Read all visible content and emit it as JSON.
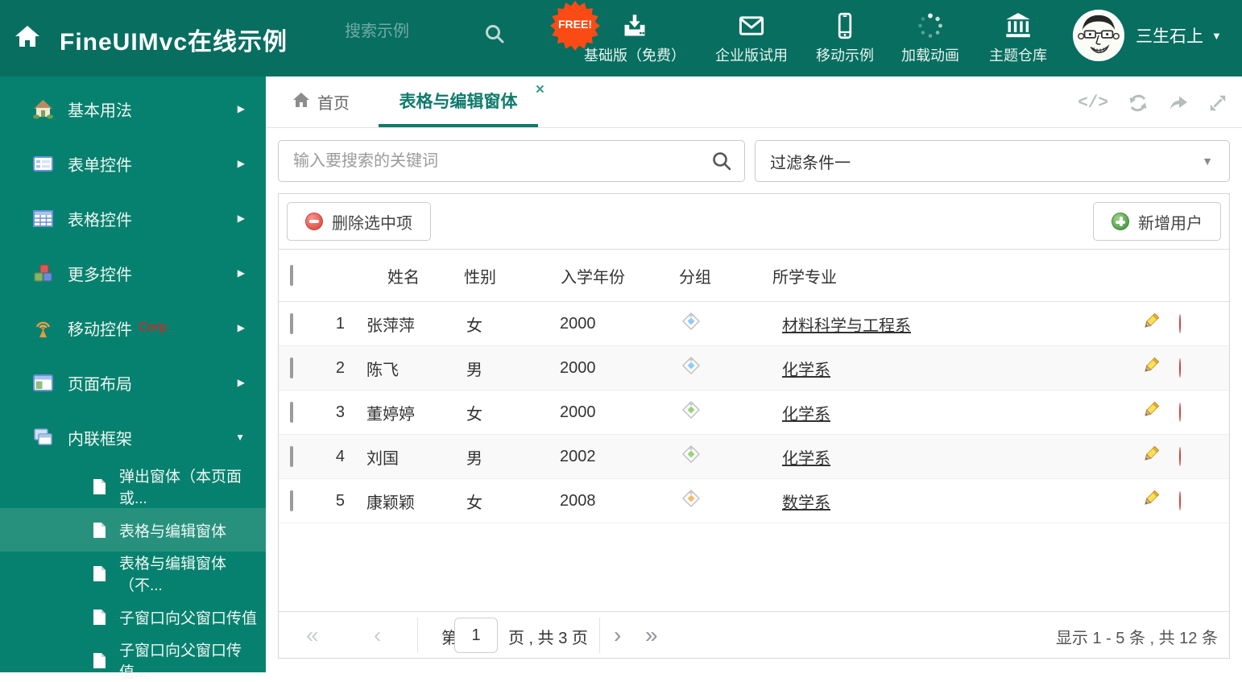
{
  "theme": {
    "topbar_bg": "#076e60",
    "sidebar_bg": "#07816f",
    "sidebar_selected_bg": "#27917e",
    "accent": "#0f7a6c",
    "badge_color": "#fb4b14",
    "danger": "#df544b",
    "success": "#4f9e49",
    "tag_blue": "#8ecdf5",
    "tag_green": "#9bd37a",
    "tag_orange": "#fbb96d"
  },
  "header": {
    "title": "FineUIMvc在线示例",
    "search_placeholder": "搜索示例",
    "badge": "FREE!",
    "nav": [
      {
        "label": "基础版（免费）",
        "icon": "download-icon"
      },
      {
        "label": "企业版试用",
        "icon": "envelope-icon"
      },
      {
        "label": "移动示例",
        "icon": "phone-icon"
      },
      {
        "label": "加载动画",
        "icon": "spinner-icon"
      },
      {
        "label": "主题仓库",
        "icon": "bank-icon"
      }
    ],
    "user_name": "三生石上"
  },
  "sidebar": {
    "items": [
      {
        "label": "基本用法",
        "icon": "home-icon"
      },
      {
        "label": "表单控件",
        "icon": "form-icon"
      },
      {
        "label": "表格控件",
        "icon": "grid-icon"
      },
      {
        "label": "更多控件",
        "icon": "cubes-icon"
      },
      {
        "label": "移动控件",
        "suffix": "Corp.",
        "icon": "antenna-icon"
      },
      {
        "label": "页面布局",
        "icon": "layout-icon"
      },
      {
        "label": "内联框架",
        "icon": "frames-icon"
      }
    ],
    "subitems": [
      {
        "label": "弹出窗体（本页面或..."
      },
      {
        "label": "表格与编辑窗体"
      },
      {
        "label": "表格与编辑窗体（不..."
      },
      {
        "label": "子窗口向父窗口传值"
      },
      {
        "label": "子窗口向父窗口传值..."
      }
    ]
  },
  "tabs": {
    "home": "首页",
    "active": "表格与编辑窗体"
  },
  "filter": {
    "search_placeholder": "输入要搜索的关键词",
    "condition": "过滤条件一"
  },
  "grid": {
    "delete_button": "删除选中项",
    "add_button": "新增用户",
    "columns": {
      "name": "姓名",
      "gender": "性别",
      "year": "入学年份",
      "group": "分组",
      "major": "所学专业"
    },
    "rows": [
      {
        "num": "1",
        "name": "张萍萍",
        "gender": "女",
        "year": "2000",
        "tag": "blue",
        "major": "材料科学与工程系"
      },
      {
        "num": "2",
        "name": "陈飞",
        "gender": "男",
        "year": "2000",
        "tag": "blue",
        "major": "化学系"
      },
      {
        "num": "3",
        "name": "董婷婷",
        "gender": "女",
        "year": "2000",
        "tag": "green",
        "major": "化学系"
      },
      {
        "num": "4",
        "name": "刘国",
        "gender": "男",
        "year": "2002",
        "tag": "green",
        "major": "化学系"
      },
      {
        "num": "5",
        "name": "康颖颖",
        "gender": "女",
        "year": "2008",
        "tag": "orange",
        "major": "数学系"
      }
    ]
  },
  "pager": {
    "prefix": "第",
    "page": "1",
    "suffix": "页 , 共 3 页",
    "summary": "显示 1 - 5 条 , 共 12 条"
  },
  "icons": {
    "first_page": "«",
    "prev_page": "‹",
    "next_page": "›",
    "last_page": "»",
    "caret_down": "▼",
    "arrow_right": "▶",
    "arrow_down": "▼",
    "close_tab": "×",
    "code_glyph": "</>"
  }
}
